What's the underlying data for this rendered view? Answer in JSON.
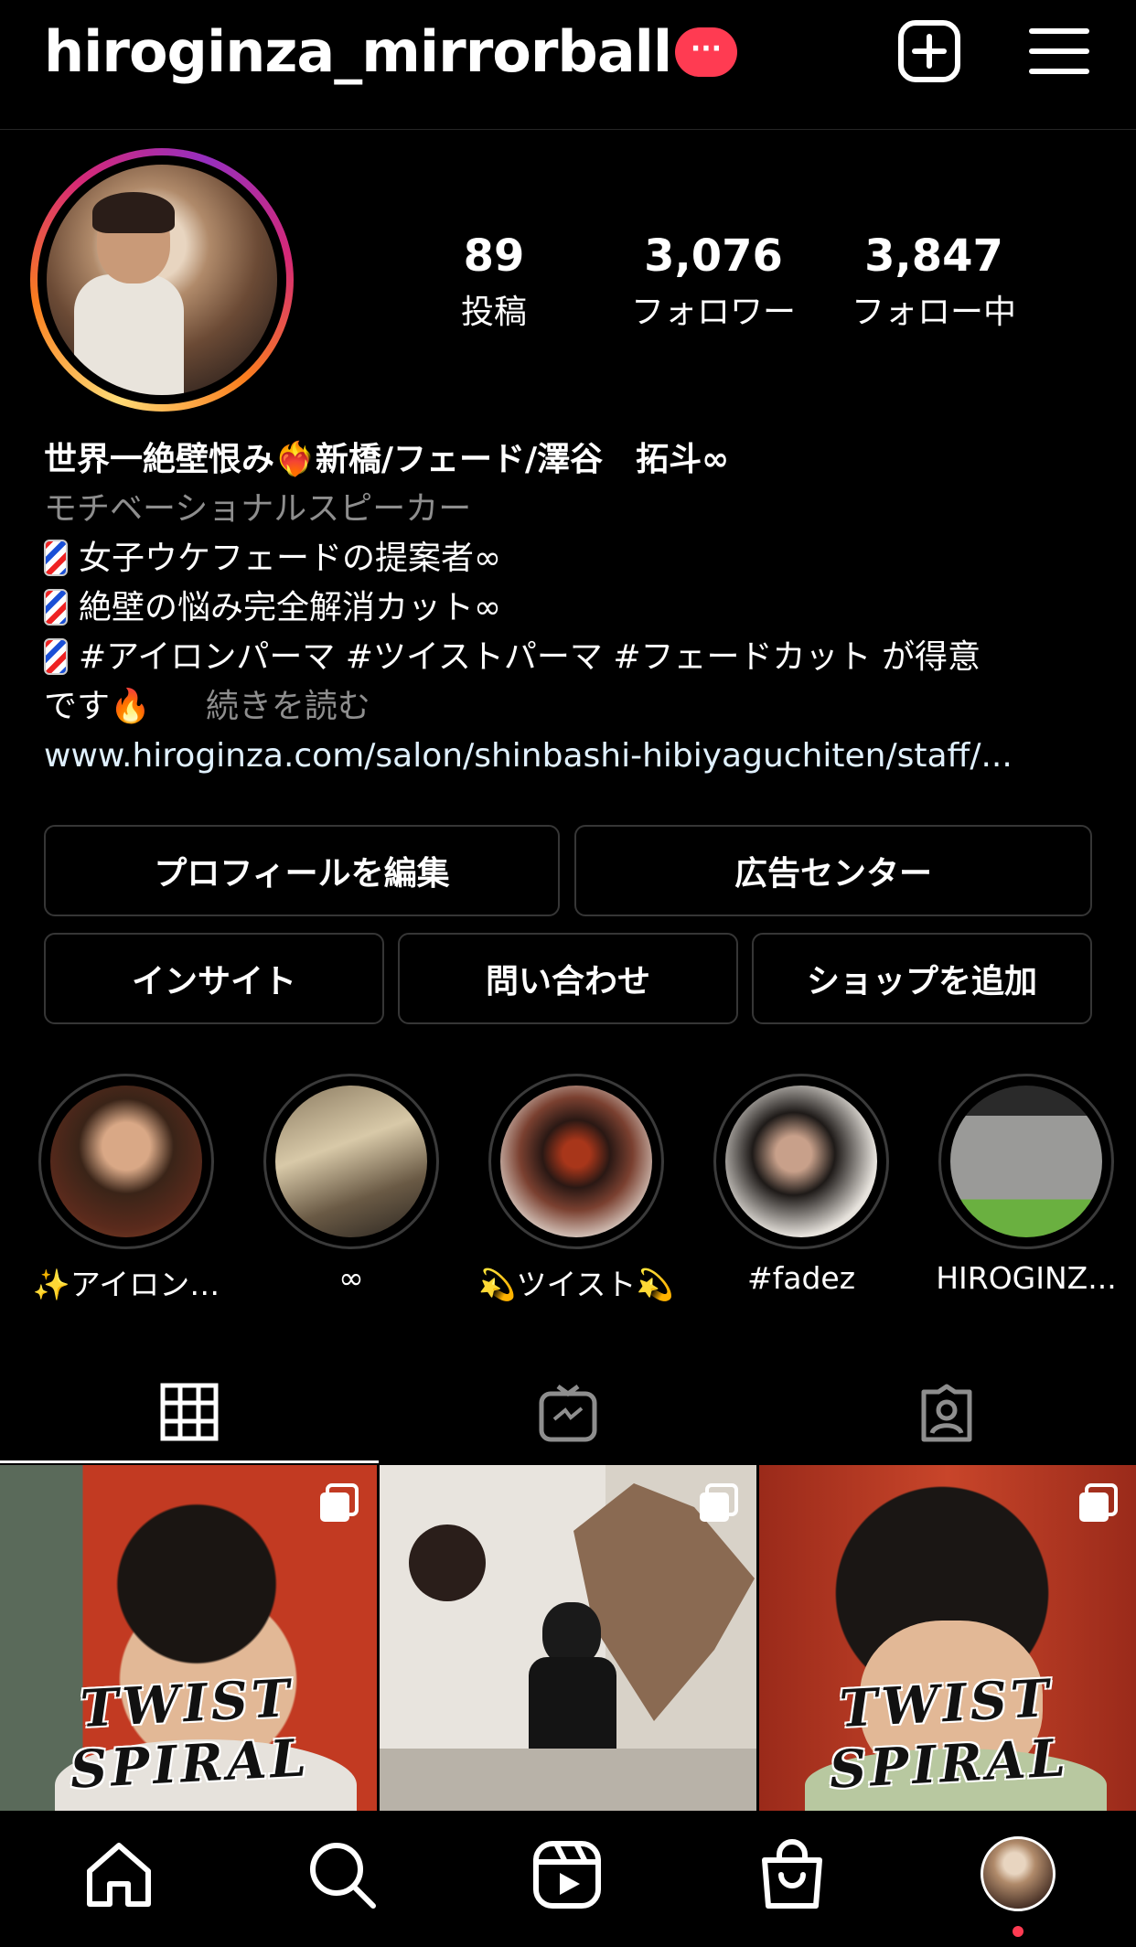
{
  "header": {
    "username": "hiroginza_mirrorball",
    "badge": "···",
    "icons": [
      "add-post-icon",
      "menu-icon"
    ]
  },
  "stats": [
    {
      "value": "89",
      "label": "投稿"
    },
    {
      "value": "3,076",
      "label": "フォロワー"
    },
    {
      "value": "3,847",
      "label": "フォロー中"
    }
  ],
  "bio": {
    "name": "世界一絶壁恨み❤️‍🔥新橋/フェード/澤谷　拓斗∞",
    "category": "モチベーショナルスピーカー",
    "lines": [
      "女子ウケフェードの提案者∞",
      "絶壁の悩み完全解消カット∞",
      "#アイロンパーマ #ツイストパーマ #フェードカット が得意"
    ],
    "last_line": "です🔥",
    "more": "続きを読む",
    "link": "www.hiroginza.com/salon/shinbashi-hibiyaguchiten/staff/..."
  },
  "buttons": {
    "edit_profile": "プロフィールを編集",
    "ad_center": "広告センター",
    "insights": "インサイト",
    "contact": "問い合わせ",
    "add_shop": "ショップを追加"
  },
  "highlights": [
    {
      "label": "✨アイロン…"
    },
    {
      "label": "∞"
    },
    {
      "label": "💫ツイスト💫"
    },
    {
      "label": "#fadez"
    },
    {
      "label": "HIROGINZ..."
    }
  ],
  "tabs": [
    "grid-icon",
    "igtv-icon",
    "tagged-icon"
  ],
  "posts": [
    {
      "caption": "TWIST SPIRAL",
      "multi": true
    },
    {
      "caption": "",
      "multi": true
    },
    {
      "caption": "TWIST SPIRAL",
      "multi": true
    }
  ],
  "bottom_nav": [
    "home-icon",
    "search-icon",
    "reels-icon",
    "shop-icon",
    "profile-avatar"
  ],
  "colors": {
    "badge": "#ff3b52",
    "button_border": "#363636",
    "muted": "#8e8e8e"
  }
}
